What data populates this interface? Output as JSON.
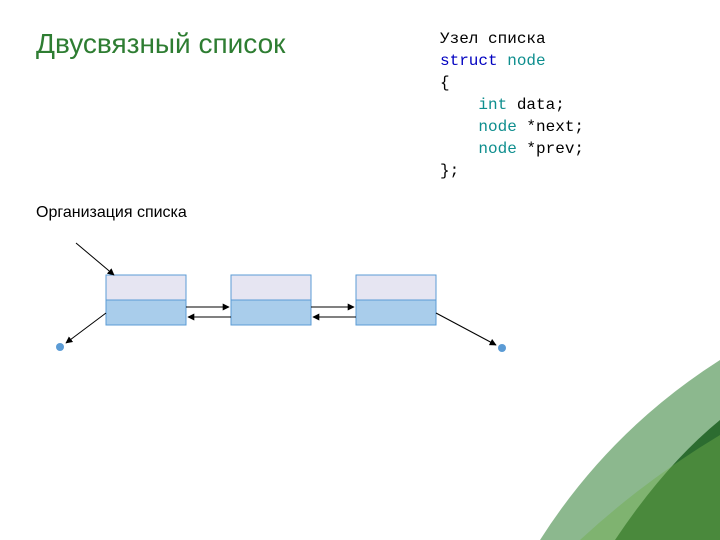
{
  "title": "Двусвязный список",
  "code_caption": "Узел списка",
  "code": {
    "line1_kw": "struct",
    "line1_ty": "node",
    "line2": "{",
    "line3_ty": "int",
    "line3_rest": " data;",
    "line4_ty": "node",
    "line4_rest": " *next;",
    "line5_ty": "node",
    "line5_rest": " *prev;",
    "line6": "};"
  },
  "subhead": "Организация списка",
  "diagram": {
    "node_count": 3,
    "node_top_fill": "#E6E5F2",
    "node_bottom_fill": "#A9CDEB",
    "node_stroke": "#5B9BD5"
  },
  "decor": {
    "leaf_light": "#2E7D32",
    "leaf_dark": "#1B5E20"
  }
}
